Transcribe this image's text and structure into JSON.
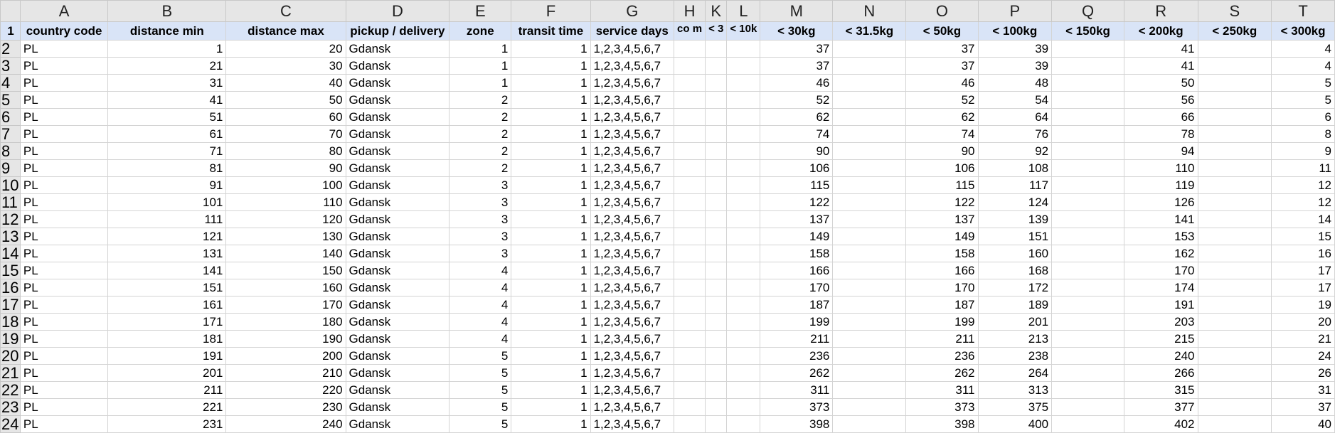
{
  "columns": [
    "A",
    "B",
    "C",
    "D",
    "E",
    "F",
    "G",
    "H",
    "K",
    "L",
    "M",
    "N",
    "O",
    "P",
    "Q",
    "R",
    "S",
    "T"
  ],
  "headers": [
    "country code",
    "distance min",
    "distance max",
    "pickup / delivery",
    "zone",
    "transit time",
    "service days",
    "co m",
    "< 3",
    "< 10k",
    "< 30kg",
    "< 31.5kg",
    "< 50kg",
    "< 100kg",
    "< 150kg",
    "< 200kg",
    "< 250kg",
    "< 300kg"
  ],
  "rows": [
    {
      "n": "2",
      "a": "PL",
      "b": "1",
      "c": "20",
      "d": "Gdansk",
      "e": "1",
      "f": "1",
      "g": "1,2,3,4,5,6,7",
      "m": "37",
      "o": "37",
      "p": "39",
      "r": "41",
      "t": "4"
    },
    {
      "n": "3",
      "a": "PL",
      "b": "21",
      "c": "30",
      "d": "Gdansk",
      "e": "1",
      "f": "1",
      "g": "1,2,3,4,5,6,7",
      "m": "37",
      "o": "37",
      "p": "39",
      "r": "41",
      "t": "4"
    },
    {
      "n": "4",
      "a": "PL",
      "b": "31",
      "c": "40",
      "d": "Gdansk",
      "e": "1",
      "f": "1",
      "g": "1,2,3,4,5,6,7",
      "m": "46",
      "o": "46",
      "p": "48",
      "r": "50",
      "t": "5"
    },
    {
      "n": "5",
      "a": "PL",
      "b": "41",
      "c": "50",
      "d": "Gdansk",
      "e": "2",
      "f": "1",
      "g": "1,2,3,4,5,6,7",
      "m": "52",
      "o": "52",
      "p": "54",
      "r": "56",
      "t": "5"
    },
    {
      "n": "6",
      "a": "PL",
      "b": "51",
      "c": "60",
      "d": "Gdansk",
      "e": "2",
      "f": "1",
      "g": "1,2,3,4,5,6,7",
      "m": "62",
      "o": "62",
      "p": "64",
      "r": "66",
      "t": "6"
    },
    {
      "n": "7",
      "a": "PL",
      "b": "61",
      "c": "70",
      "d": "Gdansk",
      "e": "2",
      "f": "1",
      "g": "1,2,3,4,5,6,7",
      "m": "74",
      "o": "74",
      "p": "76",
      "r": "78",
      "t": "8"
    },
    {
      "n": "8",
      "a": "PL",
      "b": "71",
      "c": "80",
      "d": "Gdansk",
      "e": "2",
      "f": "1",
      "g": "1,2,3,4,5,6,7",
      "m": "90",
      "o": "90",
      "p": "92",
      "r": "94",
      "t": "9"
    },
    {
      "n": "9",
      "a": "PL",
      "b": "81",
      "c": "90",
      "d": "Gdansk",
      "e": "2",
      "f": "1",
      "g": "1,2,3,4,5,6,7",
      "m": "106",
      "o": "106",
      "p": "108",
      "r": "110",
      "t": "11"
    },
    {
      "n": "10",
      "a": "PL",
      "b": "91",
      "c": "100",
      "d": "Gdansk",
      "e": "3",
      "f": "1",
      "g": "1,2,3,4,5,6,7",
      "m": "115",
      "o": "115",
      "p": "117",
      "r": "119",
      "t": "12"
    },
    {
      "n": "11",
      "a": "PL",
      "b": "101",
      "c": "110",
      "d": "Gdansk",
      "e": "3",
      "f": "1",
      "g": "1,2,3,4,5,6,7",
      "m": "122",
      "o": "122",
      "p": "124",
      "r": "126",
      "t": "12"
    },
    {
      "n": "12",
      "a": "PL",
      "b": "111",
      "c": "120",
      "d": "Gdansk",
      "e": "3",
      "f": "1",
      "g": "1,2,3,4,5,6,7",
      "m": "137",
      "o": "137",
      "p": "139",
      "r": "141",
      "t": "14"
    },
    {
      "n": "13",
      "a": "PL",
      "b": "121",
      "c": "130",
      "d": "Gdansk",
      "e": "3",
      "f": "1",
      "g": "1,2,3,4,5,6,7",
      "m": "149",
      "o": "149",
      "p": "151",
      "r": "153",
      "t": "15"
    },
    {
      "n": "14",
      "a": "PL",
      "b": "131",
      "c": "140",
      "d": "Gdansk",
      "e": "3",
      "f": "1",
      "g": "1,2,3,4,5,6,7",
      "m": "158",
      "o": "158",
      "p": "160",
      "r": "162",
      "t": "16"
    },
    {
      "n": "15",
      "a": "PL",
      "b": "141",
      "c": "150",
      "d": "Gdansk",
      "e": "4",
      "f": "1",
      "g": "1,2,3,4,5,6,7",
      "m": "166",
      "o": "166",
      "p": "168",
      "r": "170",
      "t": "17"
    },
    {
      "n": "16",
      "a": "PL",
      "b": "151",
      "c": "160",
      "d": "Gdansk",
      "e": "4",
      "f": "1",
      "g": "1,2,3,4,5,6,7",
      "m": "170",
      "o": "170",
      "p": "172",
      "r": "174",
      "t": "17"
    },
    {
      "n": "17",
      "a": "PL",
      "b": "161",
      "c": "170",
      "d": "Gdansk",
      "e": "4",
      "f": "1",
      "g": "1,2,3,4,5,6,7",
      "m": "187",
      "o": "187",
      "p": "189",
      "r": "191",
      "t": "19"
    },
    {
      "n": "18",
      "a": "PL",
      "b": "171",
      "c": "180",
      "d": "Gdansk",
      "e": "4",
      "f": "1",
      "g": "1,2,3,4,5,6,7",
      "m": "199",
      "o": "199",
      "p": "201",
      "r": "203",
      "t": "20"
    },
    {
      "n": "19",
      "a": "PL",
      "b": "181",
      "c": "190",
      "d": "Gdansk",
      "e": "4",
      "f": "1",
      "g": "1,2,3,4,5,6,7",
      "m": "211",
      "o": "211",
      "p": "213",
      "r": "215",
      "t": "21"
    },
    {
      "n": "20",
      "a": "PL",
      "b": "191",
      "c": "200",
      "d": "Gdansk",
      "e": "5",
      "f": "1",
      "g": "1,2,3,4,5,6,7",
      "m": "236",
      "o": "236",
      "p": "238",
      "r": "240",
      "t": "24"
    },
    {
      "n": "21",
      "a": "PL",
      "b": "201",
      "c": "210",
      "d": "Gdansk",
      "e": "5",
      "f": "1",
      "g": "1,2,3,4,5,6,7",
      "m": "262",
      "o": "262",
      "p": "264",
      "r": "266",
      "t": "26"
    },
    {
      "n": "22",
      "a": "PL",
      "b": "211",
      "c": "220",
      "d": "Gdansk",
      "e": "5",
      "f": "1",
      "g": "1,2,3,4,5,6,7",
      "m": "311",
      "o": "311",
      "p": "313",
      "r": "315",
      "t": "31"
    },
    {
      "n": "23",
      "a": "PL",
      "b": "221",
      "c": "230",
      "d": "Gdansk",
      "e": "5",
      "f": "1",
      "g": "1,2,3,4,5,6,7",
      "m": "373",
      "o": "373",
      "p": "375",
      "r": "377",
      "t": "37"
    },
    {
      "n": "24",
      "a": "PL",
      "b": "231",
      "c": "240",
      "d": "Gdansk",
      "e": "5",
      "f": "1",
      "g": "1,2,3,4,5,6,7",
      "m": "398",
      "o": "398",
      "p": "400",
      "r": "402",
      "t": "40"
    }
  ]
}
